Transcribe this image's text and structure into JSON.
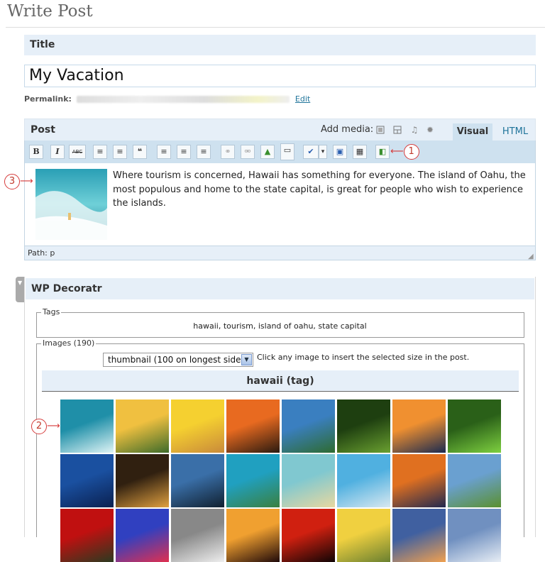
{
  "page": {
    "title": "Write Post"
  },
  "title_section": {
    "label": "Title",
    "value": "My Vacation"
  },
  "permalink": {
    "label": "Permalink:",
    "edit_label": "Edit"
  },
  "post_section": {
    "label": "Post",
    "add_media_label": "Add media:",
    "media_icons": [
      "image-icon",
      "video-icon",
      "audio-icon",
      "media-star-icon"
    ],
    "tabs": [
      {
        "label": "Visual",
        "active": true
      },
      {
        "label": "HTML",
        "active": false
      }
    ],
    "toolbar": {
      "buttons": [
        {
          "name": "bold-button",
          "glyph": "B"
        },
        {
          "name": "italic-button",
          "glyph": "I"
        },
        {
          "name": "strikethrough-button",
          "glyph": "ABC"
        },
        {
          "name": "bullet-list-button",
          "glyph": "≡"
        },
        {
          "name": "numbered-list-button",
          "glyph": "≡"
        },
        {
          "name": "blockquote-button",
          "glyph": "❝"
        },
        {
          "name": "align-left-button",
          "glyph": "≡"
        },
        {
          "name": "align-center-button",
          "glyph": "≡"
        },
        {
          "name": "align-right-button",
          "glyph": "≡"
        },
        {
          "name": "insert-link-button",
          "glyph": "⚭"
        },
        {
          "name": "unlink-button",
          "glyph": "⚮"
        },
        {
          "name": "insert-image-button",
          "glyph": "▲"
        },
        {
          "name": "insert-more-button",
          "glyph": "▭"
        },
        {
          "name": "spellcheck-button",
          "glyph": "✔"
        },
        {
          "name": "spellcheck-dropdown-button",
          "glyph": "▾"
        },
        {
          "name": "fullscreen-button",
          "glyph": "▣"
        },
        {
          "name": "kitchen-sink-button",
          "glyph": "▦"
        },
        {
          "name": "wp-decoratr-button",
          "glyph": "◧"
        }
      ]
    },
    "content": "Where tourism is concerned, Hawaii has something for everyone. The island of Oahu, the most populous and home to the state capital, is great for people who wish to experience the islands.",
    "path": "Path: p"
  },
  "callouts": {
    "one": "1",
    "two": "2",
    "three": "3"
  },
  "decoratr": {
    "label": "WP Decoratr",
    "tags_legend": "Tags",
    "tags_value": "hawaii, tourism, island of oahu, state capital",
    "images_legend": "Images (190)",
    "size_select": "thumbnail (100 on longest side)",
    "hint": "Click any image to insert the selected size in the post.",
    "group_title": "hawaii (tag)",
    "thumbnails": [
      "wave-surfer",
      "palm-tree-field",
      "gecko-on-finger",
      "palm-sunset",
      "lake-reflection",
      "green-gecko-leaf",
      "beach-sunset-bench",
      "green-gecko",
      "palm-trees-sky",
      "city-night",
      "humpback-whale",
      "sea-turtle",
      "sandy-beach",
      "swimmers-ocean",
      "sunset-clouds",
      "rainbow-field",
      "red-cardinal",
      "coral-closeup",
      "zebra-fish",
      "palm-silhouette-sunset",
      "palm-dusk",
      "toad-yellow",
      "cliff-sunset",
      "bare-tree"
    ]
  },
  "colors": {
    "accent": "#21759b",
    "header_bg": "#e6eff8",
    "toolbar_bg": "#cee1ef",
    "callout": "#d63b3b"
  }
}
